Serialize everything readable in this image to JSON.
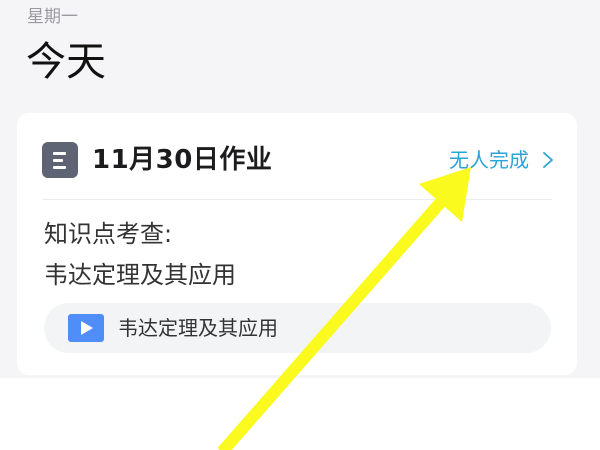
{
  "header": {
    "weekday": "星期一",
    "title": "今天"
  },
  "homework_card": {
    "title": "11月30日作业",
    "status": "无人完成",
    "topic_label": "知识点考查:",
    "topic_name": "韦达定理及其应用",
    "resource": {
      "label": "韦达定理及其应用",
      "icon": "video-play-icon"
    }
  },
  "colors": {
    "accent": "#2aa3d6",
    "icon_bg": "#5f6475",
    "video_icon": "#4f8ef7",
    "annotation_arrow": "#fafa1e"
  }
}
